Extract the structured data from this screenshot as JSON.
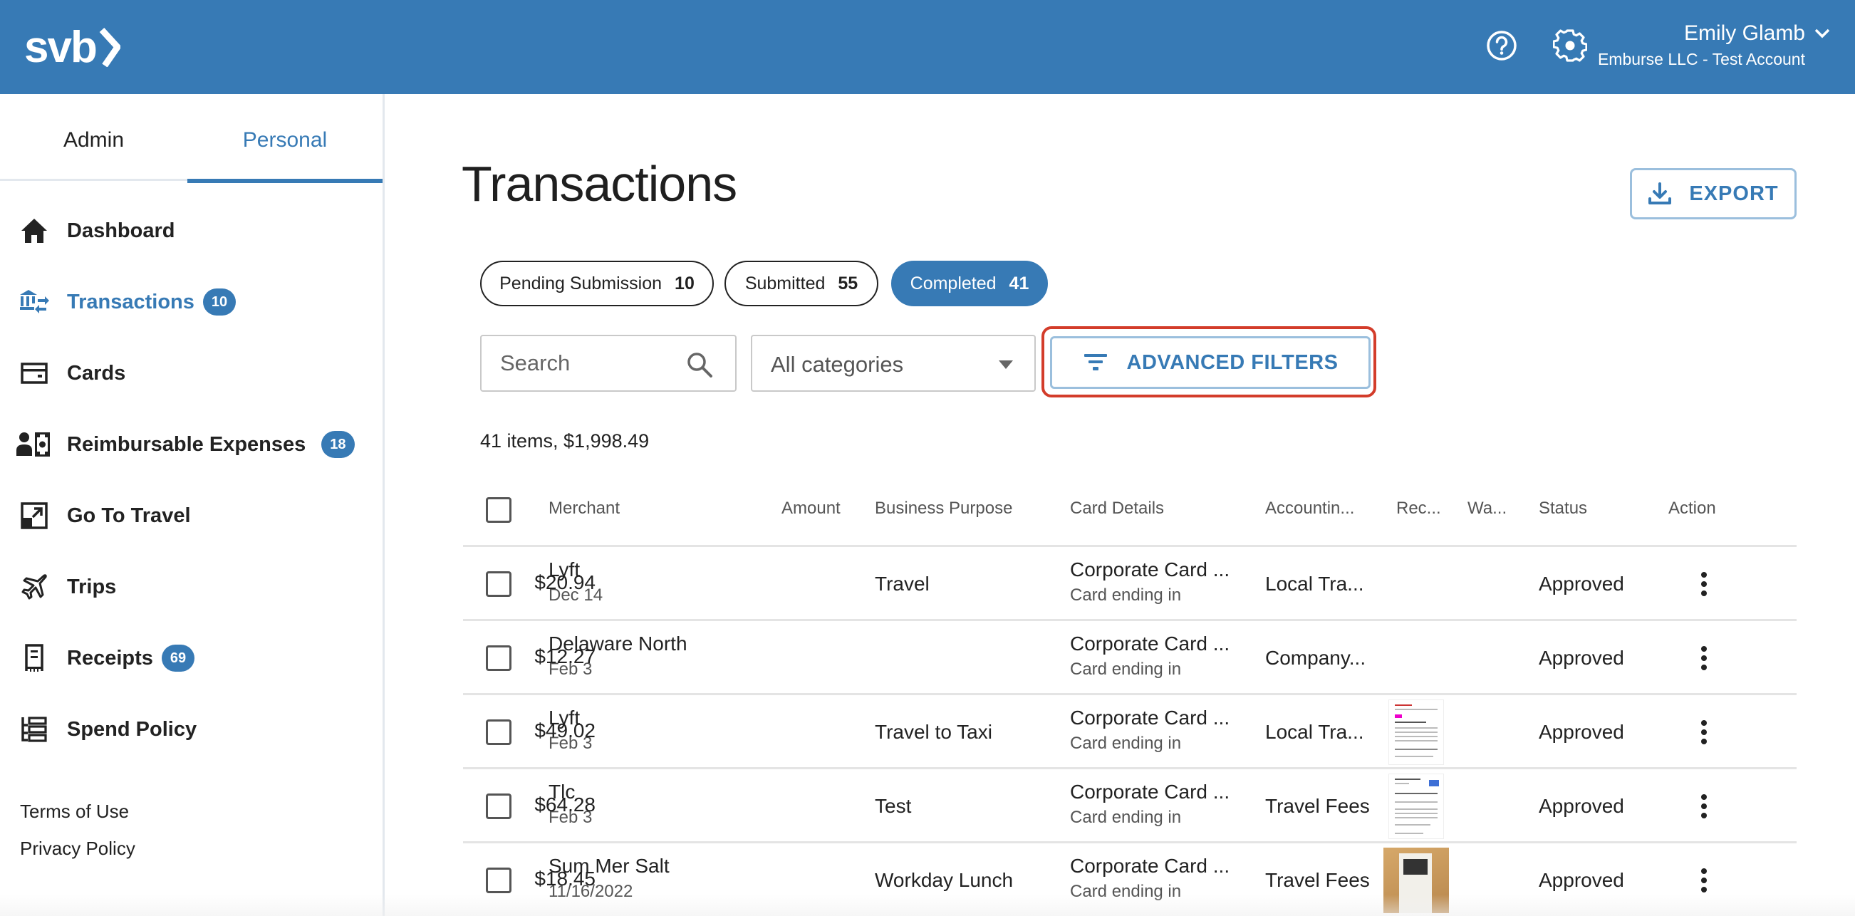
{
  "header": {
    "logo_text": "svb",
    "help_icon": "help-circle-icon",
    "settings_icon": "gear-icon",
    "user_name": "Emily Glamb",
    "user_org": "Emburse LLC - Test Account",
    "brand_color": "#377ab5"
  },
  "sidebar": {
    "tabs": [
      {
        "label": "Admin",
        "active": false
      },
      {
        "label": "Personal",
        "active": true
      }
    ],
    "items": [
      {
        "label": "Dashboard",
        "icon": "home-icon",
        "badge": null,
        "active": false
      },
      {
        "label": "Transactions",
        "icon": "bank-transfer-icon",
        "badge": "10",
        "active": true
      },
      {
        "label": "Cards",
        "icon": "card-icon",
        "badge": null,
        "active": false
      },
      {
        "label": "Reimbursable Expenses",
        "icon": "person-cash-icon",
        "badge": "18",
        "active": false
      },
      {
        "label": "Go To Travel",
        "icon": "external-link-icon",
        "badge": null,
        "active": false
      },
      {
        "label": "Trips",
        "icon": "airplane-icon",
        "badge": null,
        "active": false
      },
      {
        "label": "Receipts",
        "icon": "receipt-icon",
        "badge": "69",
        "active": false
      },
      {
        "label": "Spend Policy",
        "icon": "policy-list-icon",
        "badge": null,
        "active": false
      }
    ],
    "footer_links": [
      "Terms of Use",
      "Privacy Policy"
    ]
  },
  "main": {
    "title": "Transactions",
    "export_label": "EXPORT",
    "status_tabs": [
      {
        "label": "Pending Submission",
        "count": "10",
        "active": false
      },
      {
        "label": "Submitted",
        "count": "55",
        "active": false
      },
      {
        "label": "Completed",
        "count": "41",
        "active": true
      }
    ],
    "search": {
      "placeholder": "Search",
      "value": ""
    },
    "category_select": {
      "value": "All categories"
    },
    "advanced_filters_label": "ADVANCED FILTERS",
    "summary": "41 items, $1,998.49"
  },
  "table": {
    "columns": [
      "Merchant",
      "Amount",
      "Business Purpose",
      "Card Details",
      "Accountin...",
      "Rec...",
      "Wa...",
      "Status",
      "Action"
    ],
    "rows": [
      {
        "merchant": "Lyft",
        "date": "Dec 14",
        "amount": "$20.94",
        "purpose": "Travel",
        "card": "Corporate Card ...",
        "card_sub": "Card ending in",
        "accounting": "Local Tra...",
        "receipt": null,
        "status": "Approved"
      },
      {
        "merchant": "Delaware North",
        "date": "Feb 3",
        "amount": "$12.27",
        "purpose": "",
        "card": "Corporate Card ...",
        "card_sub": "Card ending in",
        "accounting": "Company...",
        "receipt": null,
        "status": "Approved"
      },
      {
        "merchant": "Lyft",
        "date": "Feb 3",
        "amount": "$49.02",
        "purpose": "Travel to Taxi",
        "card": "Corporate Card ...",
        "card_sub": "Card ending in",
        "accounting": "Local Tra...",
        "receipt": "email-receipt-thumbnail",
        "status": "Approved"
      },
      {
        "merchant": "Tlc",
        "date": "Feb 3",
        "amount": "$64.28",
        "purpose": "Test",
        "card": "Corporate Card ...",
        "card_sub": "Card ending in",
        "accounting": "Travel Fees",
        "receipt": "ride-receipt-thumbnail",
        "status": "Approved"
      },
      {
        "merchant": "Sum Mer Salt",
        "date": "11/16/2022",
        "amount": "$18.45",
        "purpose": "Workday Lunch",
        "card": "Corporate Card ...",
        "card_sub": "Card ending in",
        "accounting": "Travel Fees",
        "receipt": "photo-receipt-thumbnail",
        "status": "Approved"
      }
    ]
  }
}
